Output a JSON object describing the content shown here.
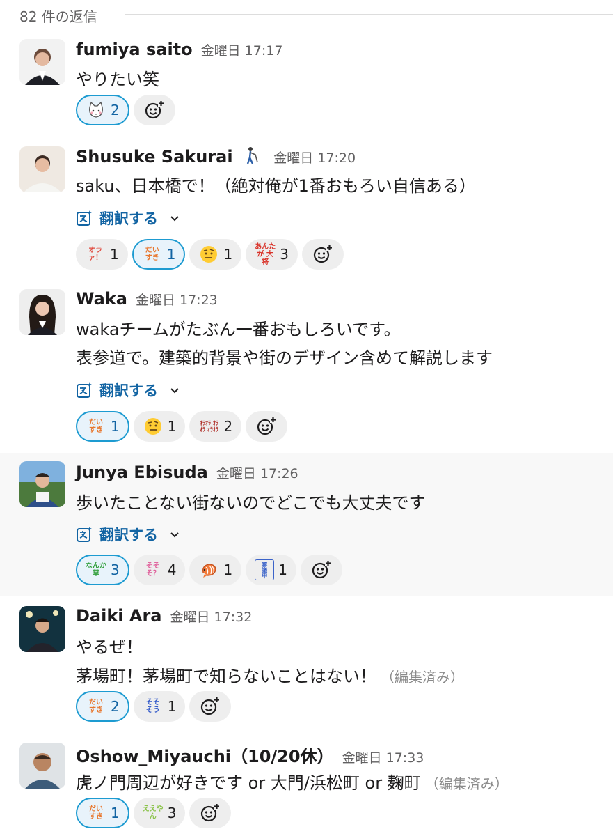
{
  "thread": {
    "reply_count": "82 件の返信"
  },
  "messages": [
    {
      "author": "fumiya saito",
      "time": "金曜日 17:17",
      "lines": [
        "やりたい笑"
      ],
      "reactions": [
        {
          "emoji": "cat-face-emoji",
          "count": "2",
          "mine": true
        }
      ]
    },
    {
      "author": "Shusuke Sakurai",
      "status_icon": "golfer-icon",
      "time": "金曜日 17:20",
      "lines": [
        "saku、日本橋で！（絶対俺が1番おもろい自信ある）"
      ],
      "translate": "翻訳する",
      "reactions": [
        {
          "emoji_text": "オラ ァ！",
          "count": "1",
          "mine": false,
          "color": "#e0463a"
        },
        {
          "emoji_text": "だい すき",
          "count": "1",
          "mine": true,
          "color": "#e8772e"
        },
        {
          "emoji": "raised-eyebrow-face-emoji",
          "count": "1",
          "mine": false
        },
        {
          "emoji_text": "あんたが 大将",
          "count": "3",
          "mine": false,
          "color": "#d9342b"
        }
      ]
    },
    {
      "author": "Waka",
      "time": "金曜日 17:23",
      "lines": [
        "wakaチームがたぶん一番おもしろいです。",
        "表参道で。建築的背景や街のデザイン含めて解説します"
      ],
      "translate": "翻訳する",
      "reactions": [
        {
          "emoji_text": "だい すき",
          "count": "1",
          "mine": true,
          "color": "#e8772e"
        },
        {
          "emoji": "raised-eyebrow-face-emoji",
          "count": "1",
          "mine": false
        },
        {
          "emoji_text": "ｵﾗｵﾗ ｵﾗｵﾗ ｵﾗｵﾗ",
          "count": "2",
          "mine": false,
          "color": "#b0302a"
        }
      ]
    },
    {
      "author": "Junya Ebisuda",
      "time": "金曜日 17:26",
      "lines": [
        "歩いたことない街ないのでどこでも大丈夫です"
      ],
      "translate": "翻訳する",
      "reactions": [
        {
          "emoji_text": "なんか 草",
          "count": "3",
          "mine": true,
          "color": "#2f9e3a"
        },
        {
          "emoji_text": "そそ そ？",
          "count": "4",
          "mine": false,
          "color": "#e0609b"
        },
        {
          "emoji": "shrimp-emoji",
          "count": "1",
          "mine": false
        },
        {
          "emoji_text": "審議中",
          "count": "1",
          "mine": false,
          "color": "#3b63c9"
        }
      ]
    },
    {
      "author": "Daiki Ara",
      "time": "金曜日 17:32",
      "lines": [
        "やるぜ！",
        "茅場町！茅場町で知らないことはない！"
      ],
      "edited": "（編集済み）",
      "reactions": [
        {
          "emoji_text": "だい すき",
          "count": "2",
          "mine": true,
          "color": "#e8772e"
        },
        {
          "emoji_text": "そそ そう",
          "count": "1",
          "mine": false,
          "color": "#2f57c9"
        }
      ]
    },
    {
      "author": "Oshow_Miyauchi（10/20休）",
      "time": "金曜日 17:33",
      "lines": [
        "虎ノ門周辺が好きです or 大門/浜松町 or 麹町"
      ],
      "edited": "（編集済み）",
      "reactions": [
        {
          "emoji_text": "だい すき",
          "count": "1",
          "mine": true,
          "color": "#e8772e"
        },
        {
          "emoji_text": "ええやん",
          "count": "3",
          "mine": false,
          "color": "#8bc34a"
        }
      ]
    }
  ],
  "colors": {
    "link": "#1264a3",
    "highlight_row": "#f8f8f8",
    "mine_border": "#1d9bd1"
  }
}
